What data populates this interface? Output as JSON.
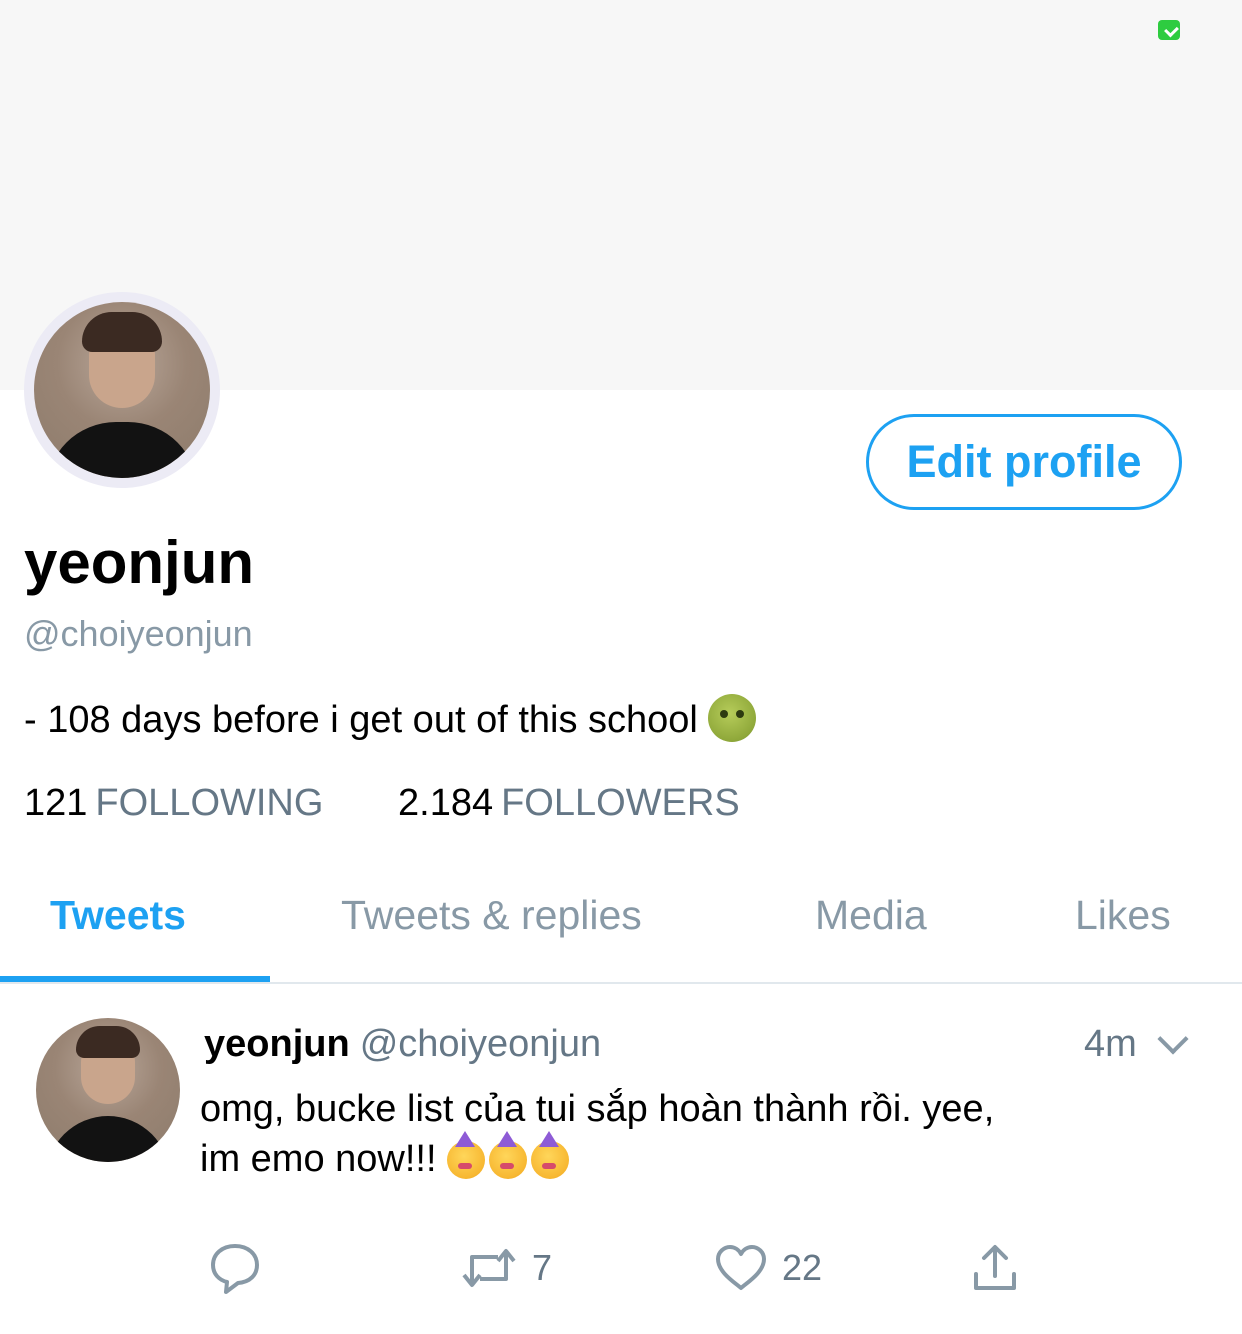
{
  "profile": {
    "display_name": "yeonjun",
    "handle": "@choiyeonjun",
    "bio": "- 108 days before i get out of this school",
    "edit_button": "Edit profile",
    "following_count": "121",
    "following_label": "FOLLOWING",
    "followers_count": "2.184",
    "followers_label": "FOLLOWERS"
  },
  "tabs": [
    {
      "label": "Tweets",
      "active": true
    },
    {
      "label": "Tweets & replies",
      "active": false
    },
    {
      "label": "Media",
      "active": false
    },
    {
      "label": "Likes",
      "active": false
    }
  ],
  "tweet": {
    "name": "yeonjun",
    "handle": "@choiyeonjun",
    "time": "4m",
    "text_line1": "omg, bucke list của tui sắp hoàn thành rồi. yee,",
    "text_line2": "im emo now!!!",
    "retweets": "7",
    "likes": "22"
  },
  "icons": {
    "bio_emoji": "nauseated-face-icon",
    "tweet_emoji": "partying-face-icon",
    "reply": "reply-icon",
    "retweet": "retweet-icon",
    "like": "heart-icon",
    "share": "share-icon",
    "battery": "battery-icon",
    "chevron": "chevron-down-icon"
  },
  "colors": {
    "accent": "#1da1f2",
    "muted": "#657786",
    "light_muted": "#8899a6",
    "battery_green": "#2ecc40"
  }
}
